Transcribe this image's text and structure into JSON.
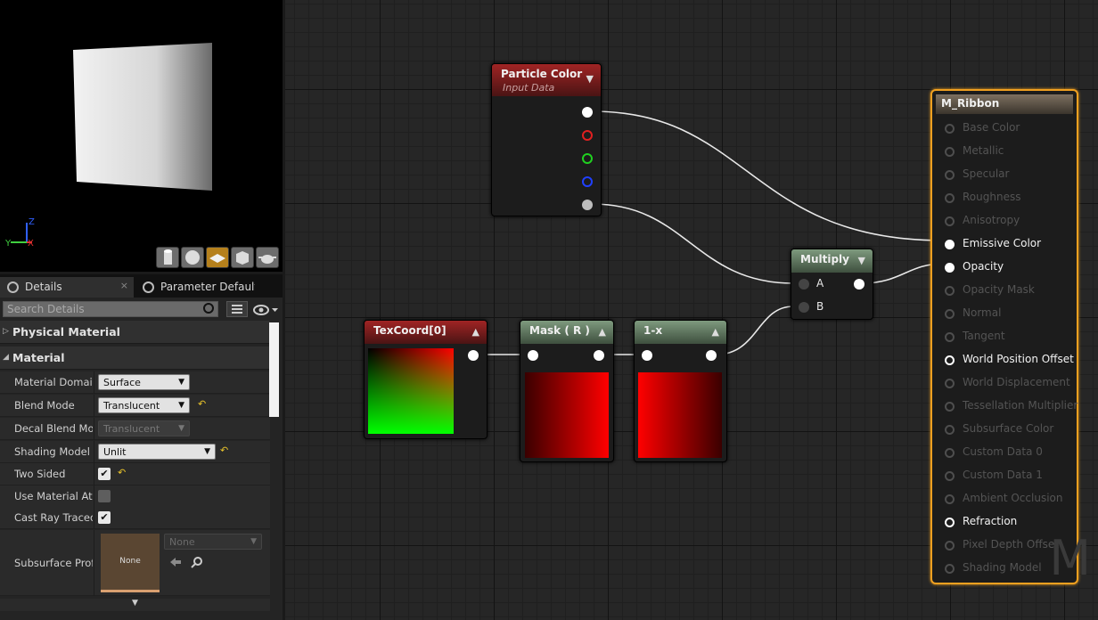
{
  "viewport": {
    "axis_labels": {
      "z": "Z",
      "y": "Y",
      "x": "X"
    },
    "buttons": [
      {
        "icon": "cylinder-icon"
      },
      {
        "icon": "sphere-icon"
      },
      {
        "icon": "plane-icon",
        "active": true
      },
      {
        "icon": "cube-icon"
      },
      {
        "icon": "teapot-icon"
      }
    ]
  },
  "details": {
    "tabs": [
      {
        "label": "Details",
        "close": "×"
      },
      {
        "label": "Parameter Defaults"
      }
    ],
    "search_placeholder": "Search Details",
    "categories": {
      "physical_material": "Physical Material",
      "material": "Material"
    },
    "props": {
      "material_domain": {
        "label": "Material Domain",
        "value": "Surface"
      },
      "blend_mode": {
        "label": "Blend Mode",
        "value": "Translucent"
      },
      "decal_blend_mode": {
        "label": "Decal Blend Mode",
        "value": "Translucent"
      },
      "shading_model": {
        "label": "Shading Model",
        "value": "Unlit"
      },
      "two_sided": {
        "label": "Two Sided",
        "checked": true
      },
      "use_material_attributes": {
        "label": "Use Material Attributes",
        "checked": false
      },
      "cast_ray_traced_shadows": {
        "label": "Cast Ray Traced Shadows",
        "checked": true
      },
      "subsurface_profile": {
        "label": "Subsurface Profile",
        "thumb": "None",
        "value": "None"
      }
    },
    "reset_symbol": "↶",
    "check_symbol": "✔"
  },
  "graph": {
    "particle_color": {
      "title": "Particle Color",
      "subtitle": "Input Data"
    },
    "texcoord": {
      "title": "TexCoord[0]"
    },
    "mask": {
      "title": "Mask ( R )"
    },
    "one_minus": {
      "title": "1-x"
    },
    "multiply": {
      "title": "Multiply",
      "pin_a": "A",
      "pin_b": "B"
    },
    "result": {
      "title": "M_Ribbon",
      "watermark": "M",
      "pins": [
        {
          "label": "Base Color",
          "state": "off"
        },
        {
          "label": "Metallic",
          "state": "off"
        },
        {
          "label": "Specular",
          "state": "off"
        },
        {
          "label": "Roughness",
          "state": "off"
        },
        {
          "label": "Anisotropy",
          "state": "off"
        },
        {
          "label": "Emissive Color",
          "state": "connected"
        },
        {
          "label": "Opacity",
          "state": "connected"
        },
        {
          "label": "Opacity Mask",
          "state": "off"
        },
        {
          "label": "Normal",
          "state": "off"
        },
        {
          "label": "Tangent",
          "state": "off"
        },
        {
          "label": "World Position Offset",
          "state": "available"
        },
        {
          "label": "World Displacement",
          "state": "off"
        },
        {
          "label": "Tessellation Multiplier",
          "state": "off"
        },
        {
          "label": "Subsurface Color",
          "state": "off"
        },
        {
          "label": "Custom Data 0",
          "state": "off"
        },
        {
          "label": "Custom Data 1",
          "state": "off"
        },
        {
          "label": "Ambient Occlusion",
          "state": "off"
        },
        {
          "label": "Refraction",
          "state": "available"
        },
        {
          "label": "Pixel Depth Offset",
          "state": "off"
        },
        {
          "label": "Shading Model",
          "state": "off"
        }
      ]
    }
  }
}
